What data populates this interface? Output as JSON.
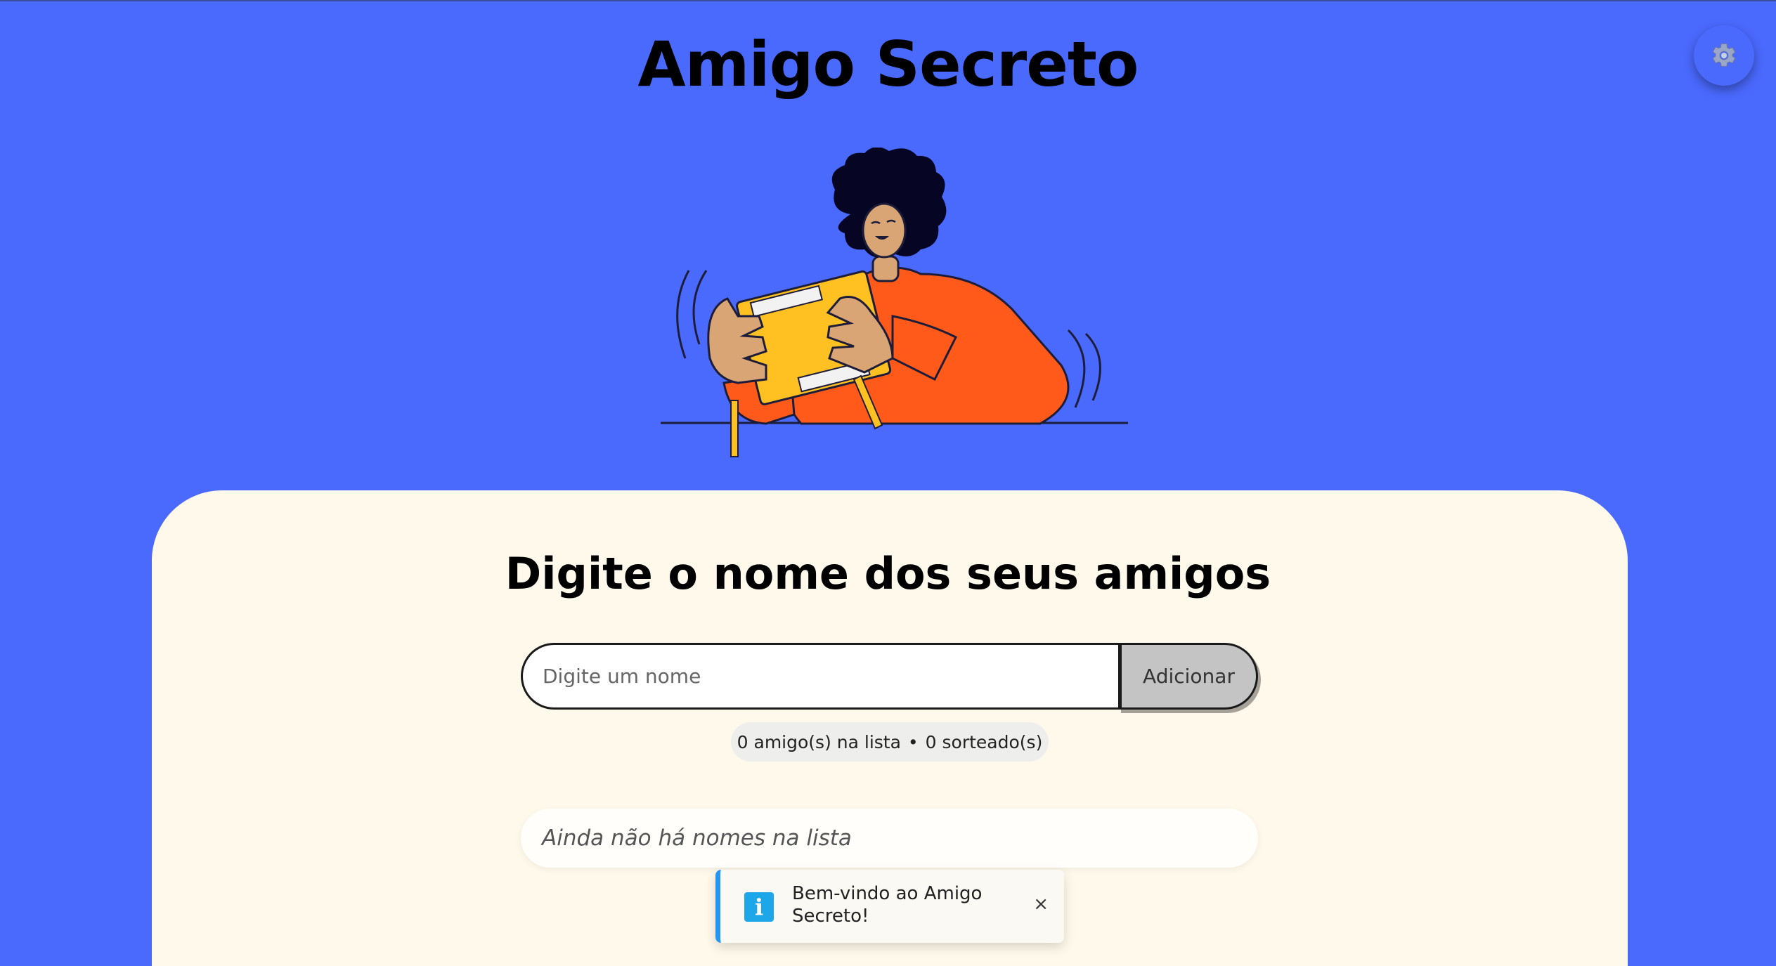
{
  "header": {
    "title": "Amigo Secreto",
    "settings_icon": "gear-icon"
  },
  "hero": {
    "illustration": "person-shaking-gift-box"
  },
  "main": {
    "section_title": "Digite o nome dos seus amigos",
    "name_input": {
      "value": "",
      "placeholder": "Digite um nome"
    },
    "add_button_label": "Adicionar",
    "counter": {
      "friends_text": "0 amigo(s) na lista",
      "separator": "•",
      "drawn_text": "0 sorteado(s)"
    },
    "empty_list_text": "Ainda não há nomes na lista"
  },
  "toast": {
    "icon": "info-icon",
    "icon_glyph": "i",
    "message": "Bem-vindo ao Amigo Secreto!",
    "close_glyph": "×"
  },
  "colors": {
    "background": "#4a69fd",
    "card": "#fff9eb",
    "toast_accent": "#2196f3"
  }
}
